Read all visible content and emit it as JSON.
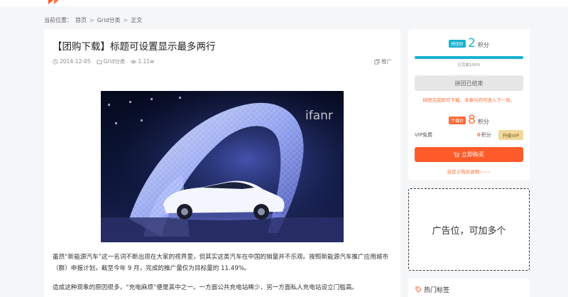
{
  "breadcrumb": {
    "prefix": "当前位置：",
    "home": "首页",
    "category": "Grid分类",
    "current": "正文",
    "separator": ">"
  },
  "article": {
    "title": "【团购下载】标题可设置显示最多两行",
    "date": "2014-12-05",
    "category": "Grid分类",
    "views": "1.11w",
    "promo_label": "推广",
    "image_watermark": "ifanr",
    "paragraphs": [
      "虽然“新能源汽车”这一名词不断出现在大家的视界里，但其实这类汽车在中国的销量并不乐观。按照新能源汽车推广应用城市（群）申报计划，截至今年 9 月，完成的推广量仅为目标量的 11.49%。",
      "造成这种现象的原因很多，“充电麻烦”便是其中之一。一方面公共充电站稀少，另一方面私人充电站设立门槛高。"
    ]
  },
  "group_buy": {
    "badge": "拼团价",
    "price": "2",
    "unit": "积分",
    "progress_percent": 100,
    "progress_text": "已完成100%",
    "ended_label": "拼团已结束",
    "notice": "拼团完成即可下载，未参与的可进入下一轮。"
  },
  "download": {
    "badge": "下载价",
    "price": "8",
    "unit": "积分",
    "vip_label": "VIP免费",
    "vip_value": "0",
    "vip_unit": "积分",
    "upgrade_label": "升级VIP",
    "buy_label": "立即购买",
    "custom_link": "自定义购买说明~~~"
  },
  "ad": {
    "text": "广告位，可加多个"
  },
  "hot_tags": {
    "title": "热门标签"
  },
  "colors": {
    "accent_blue": "#16b1cf",
    "accent_orange": "#ff5a29",
    "page_bg": "#f5f6f8"
  },
  "icons": {
    "date": "clock-icon",
    "category": "folder-icon",
    "views": "eye-icon",
    "promo": "copy-icon",
    "buy": "cart-icon",
    "tags": "tag-icon"
  }
}
